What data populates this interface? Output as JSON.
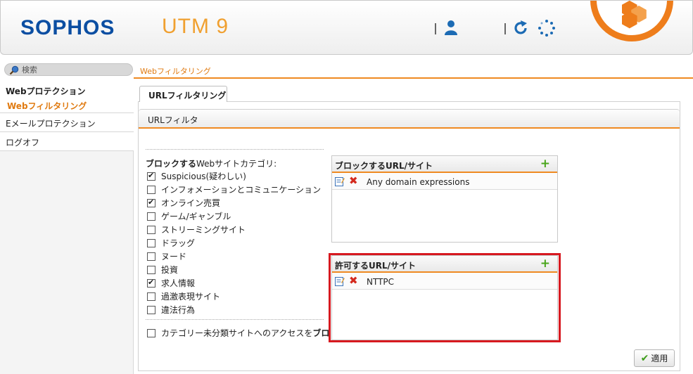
{
  "header": {
    "brand": "SOPHOS",
    "product": "UTM 9",
    "icons": [
      "user-icon",
      "refresh-icon",
      "spinner-icon",
      "brand-badge"
    ],
    "colors": {
      "brand_blue": "#0b4ea2",
      "accent_orange": "#ef8a21"
    }
  },
  "search": {
    "placeholder": "検索"
  },
  "breadcrumb": "Webフィルタリング",
  "sidebar": {
    "section_title": "Webプロテクション",
    "active_item": "Webフィルタリング",
    "items": [
      "Eメールプロテクション",
      "ログオフ"
    ]
  },
  "tabs": [
    {
      "label": "URLフィルタリング"
    }
  ],
  "panel": {
    "title": "URLフィルタ",
    "category_heading_bold": "ブロックする",
    "category_heading_rest": "Webサイトカテゴリ:",
    "categories": [
      {
        "label": "Suspicious(疑わしい)",
        "checked": true
      },
      {
        "label": "インフォメーションとコミュニケーション",
        "checked": false
      },
      {
        "label": "オンライン売買",
        "checked": true
      },
      {
        "label": "ゲーム/ギャンブル",
        "checked": false
      },
      {
        "label": "ストリーミングサイト",
        "checked": false
      },
      {
        "label": "ドラッグ",
        "checked": false
      },
      {
        "label": "ヌード",
        "checked": false
      },
      {
        "label": "投資",
        "checked": false
      },
      {
        "label": "求人情報",
        "checked": true
      },
      {
        "label": "過激表現サイト",
        "checked": false
      },
      {
        "label": "違法行為",
        "checked": false
      }
    ],
    "uncategorized_label_rest": "カテゴリー未分類サイトへのアクセスを",
    "uncategorized_label_bold": "ブロック"
  },
  "blocked_box": {
    "title": "ブロックするURL/サイト",
    "entries": [
      "Any domain expressions"
    ]
  },
  "allowed_box": {
    "title": "許可するURL/サイト",
    "entries": [
      "NTTPC"
    ]
  },
  "apply_button": {
    "label": "適用"
  }
}
